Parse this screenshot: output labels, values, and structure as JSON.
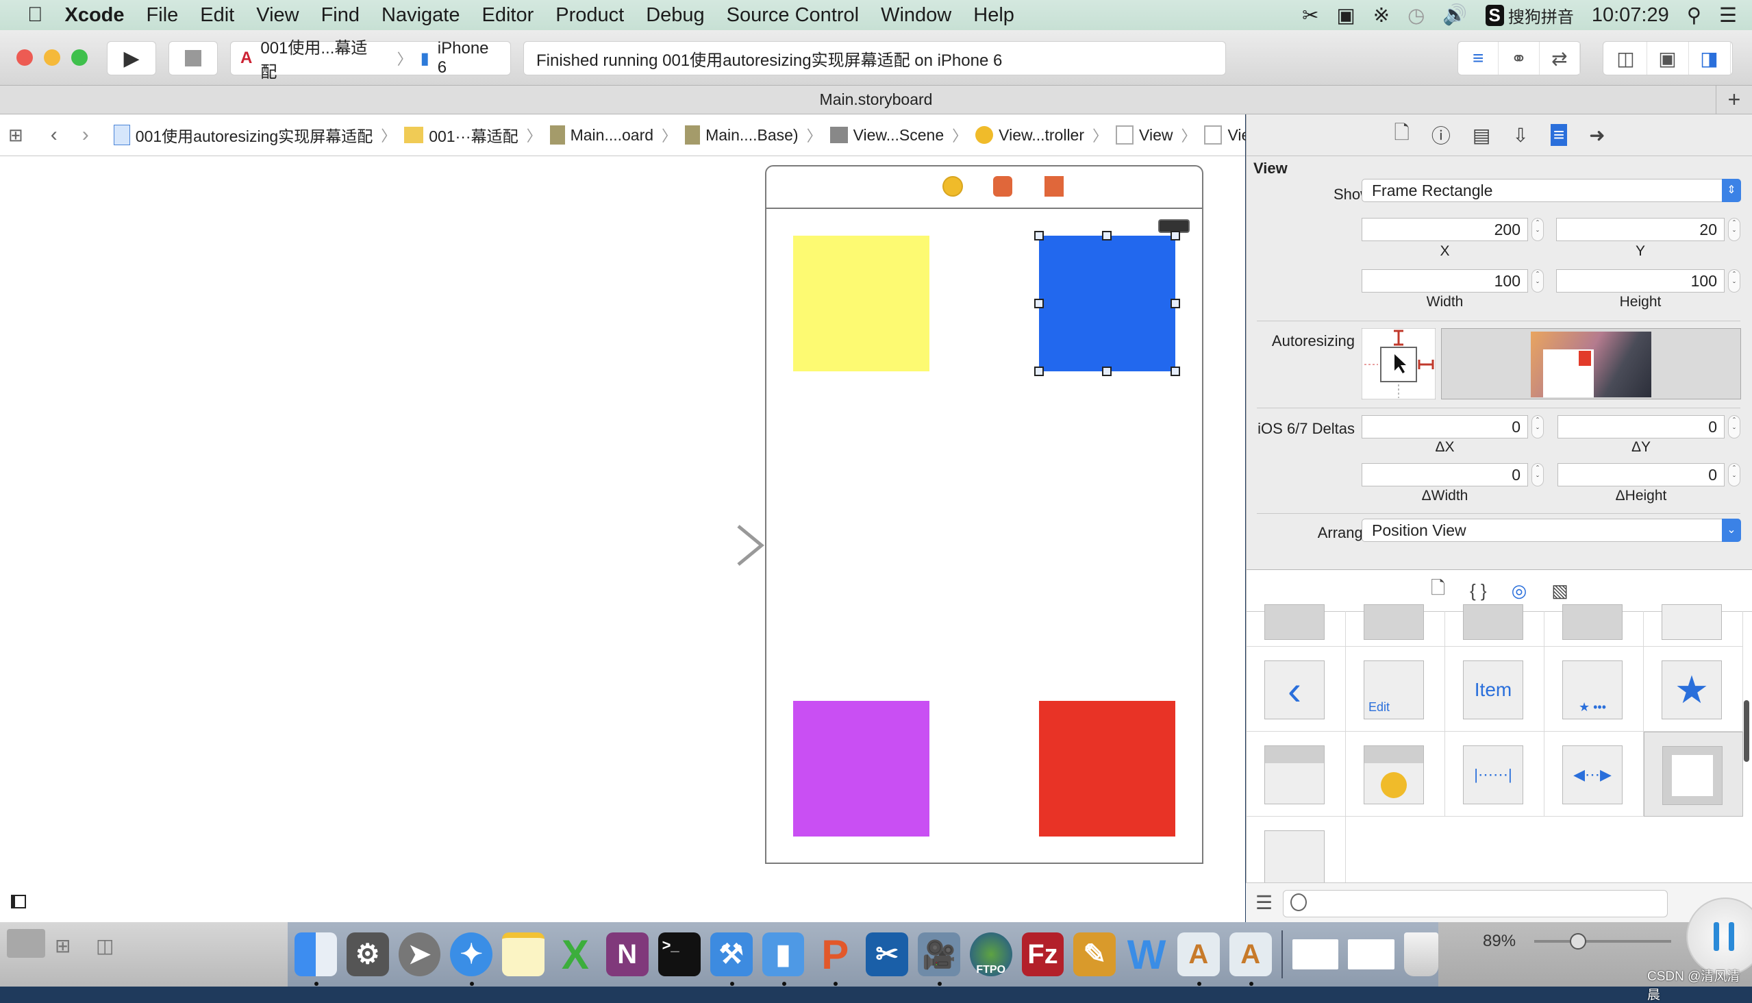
{
  "menubar": {
    "apple": "",
    "items": [
      "Xcode",
      "File",
      "Edit",
      "View",
      "Find",
      "Navigate",
      "Editor",
      "Product",
      "Debug",
      "Source Control",
      "Window",
      "Help"
    ],
    "status_icons": [
      "scissors-icon",
      "camera-icon",
      "bluetooth-icon",
      "time-machine-icon",
      "volume-icon"
    ],
    "input_method": "搜狗拼音",
    "input_badge": "S",
    "clock": "10:07:29"
  },
  "toolbar": {
    "scheme": "001使用...幕适配",
    "device": "iPhone 6",
    "status": "Finished running 001使用autoresizing实现屏幕适配 on iPhone 6"
  },
  "tabbar": {
    "title": "Main.storyboard",
    "add": "+"
  },
  "jumpbar": {
    "crumbs": [
      "001使用autoresizing实现屏幕适配",
      "001···幕适配",
      "Main....oard",
      "Main....Base)",
      "View...Scene",
      "View...troller",
      "View",
      "View"
    ]
  },
  "canvas": {
    "squares": [
      {
        "name": "yellow-view",
        "color": "#fdfa72"
      },
      {
        "name": "blue-view",
        "color": "#2268ee",
        "selected": true
      },
      {
        "name": "purple-view",
        "color": "#c94ff3"
      },
      {
        "name": "red-view",
        "color": "#e83326"
      }
    ]
  },
  "inspector": {
    "section": "View",
    "show_label": "Show",
    "show_value": "Frame Rectangle",
    "x": "200",
    "x_label": "X",
    "y": "20",
    "y_label": "Y",
    "width": "100",
    "width_label": "Width",
    "height": "100",
    "height_label": "Height",
    "autoresizing_label": "Autoresizing",
    "deltas_label": "iOS 6/7 Deltas",
    "dx": "0",
    "dx_label": "ΔX",
    "dy": "0",
    "dy_label": "ΔY",
    "dw": "0",
    "dw_label": "ΔWidth",
    "dh": "0",
    "dh_label": "ΔHeight",
    "arrange_label": "Arrange",
    "arrange_value": "Position View"
  },
  "library": {
    "tiles_row2": [
      "‹",
      "Edit",
      "Item",
      "★ •••",
      "★"
    ]
  },
  "bottom": {
    "zoom_percent": "89%",
    "watermark": "CSDN @清风清晨"
  },
  "dock": {
    "apps": [
      "Finder",
      "System Preferences",
      "Launchpad",
      "Safari",
      "Notes",
      "Excel",
      "OneNote",
      "Terminal",
      "Xcode",
      "Simulator",
      "Paw",
      "Screenshot",
      "Movie",
      "FTP",
      "FileZilla",
      "Paint",
      "Word",
      "Instruments",
      "Instruments"
    ]
  }
}
